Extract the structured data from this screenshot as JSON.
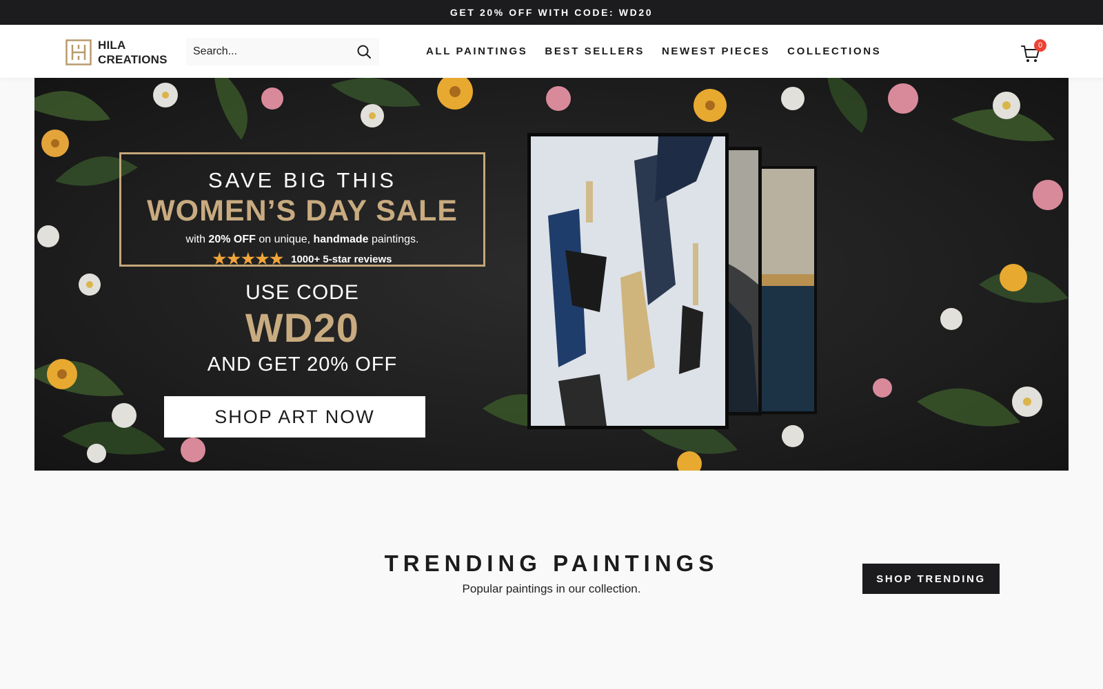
{
  "announcement": {
    "text": "GET 20% OFF WITH CODE: WD20"
  },
  "header": {
    "logo": {
      "line1": "HILA",
      "line2": "CREATIONS"
    },
    "search": {
      "placeholder": "Search..."
    },
    "nav": [
      {
        "label": "ALL PAINTINGS"
      },
      {
        "label": "BEST SELLERS"
      },
      {
        "label": "NEWEST PIECES"
      },
      {
        "label": "COLLECTIONS"
      }
    ],
    "cart": {
      "count": "0"
    }
  },
  "hero": {
    "headline_1": "SAVE BIG THIS",
    "headline_2": "WOMEN’S DAY SALE",
    "offer": {
      "prefix": "with ",
      "discount": "20% OFF",
      "middle": " on unique, ",
      "emphasis": "handmade",
      "suffix": " paintings."
    },
    "reviews": {
      "stars": "★★★★★",
      "text": "1000+ 5-star reviews"
    },
    "use_code": "USE CODE",
    "code": "WD20",
    "get_off": "AND GET 20% OFF",
    "cta": "SHOP ART NOW"
  },
  "trending": {
    "title": "TRENDING PAINTINGS",
    "subtitle": "Popular paintings in our collection.",
    "button": "SHOP TRENDING"
  },
  "colors": {
    "dark": "#1c1c1e",
    "gold": "#c9ab80",
    "badge": "#ea4335",
    "star": "#f2a53a"
  },
  "icons": [
    "logo-monogram-icon",
    "search-icon",
    "cart-icon"
  ]
}
